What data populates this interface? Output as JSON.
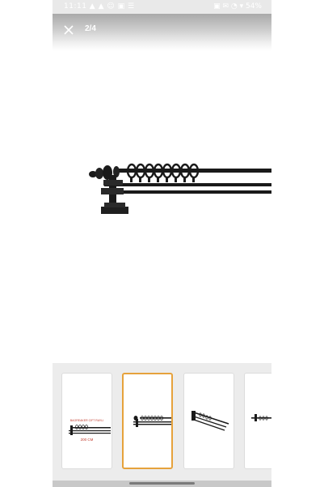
{
  "status_bar": {
    "time_icons": "11:11 ▲ ▲ ☺ ▣ ☰",
    "right_icons": "▣ ✉ ◔ ▾ 54%"
  },
  "viewer": {
    "counter": "2/4",
    "close_icon": "close-icon"
  },
  "thumbnails": [
    {
      "label": "thumbnail-1",
      "caption_top": "BAGREAKER CIFT RAYLI",
      "caption_bottom": "200 CM",
      "selected": false
    },
    {
      "label": "thumbnail-2",
      "selected": true
    },
    {
      "label": "thumbnail-3",
      "selected": false
    },
    {
      "label": "thumbnail-4",
      "selected": false
    }
  ],
  "colors": {
    "accent": "#e6a23c",
    "rod": "#1a1a1a"
  }
}
